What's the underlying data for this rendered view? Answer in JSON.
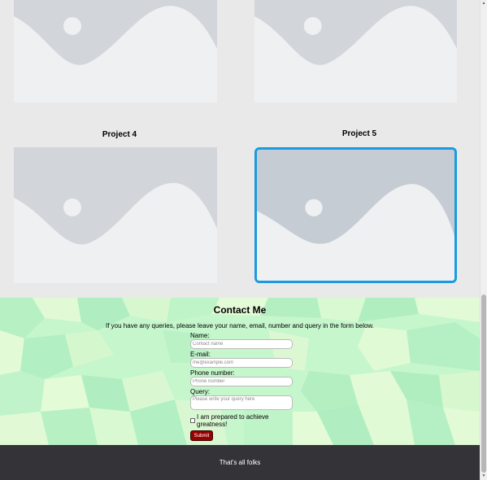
{
  "projects": [
    {
      "title": ""
    },
    {
      "title": ""
    },
    {
      "title": "Project 4"
    },
    {
      "title": "Project 5",
      "selected": true
    }
  ],
  "contact": {
    "heading": "Contact Me",
    "intro": "If you have any queries, please leave your name, email, number and query in the form below.",
    "name_label": "Name:",
    "name_placeholder": "Contact name",
    "email_label": "E-mail:",
    "email_placeholder": "me@example.com",
    "phone_label": "Phone number:",
    "phone_placeholder": "Phone number",
    "query_label": "Query:",
    "query_placeholder": "Please write your query here",
    "checkbox_label": "I am prepared to achieve greatness!",
    "submit_label": "Submit"
  },
  "footer": {
    "text": "That's all folks"
  },
  "colors": {
    "selection_border": "#1a9be0",
    "submit_bg": "#990000",
    "footer_bg": "#343438"
  }
}
